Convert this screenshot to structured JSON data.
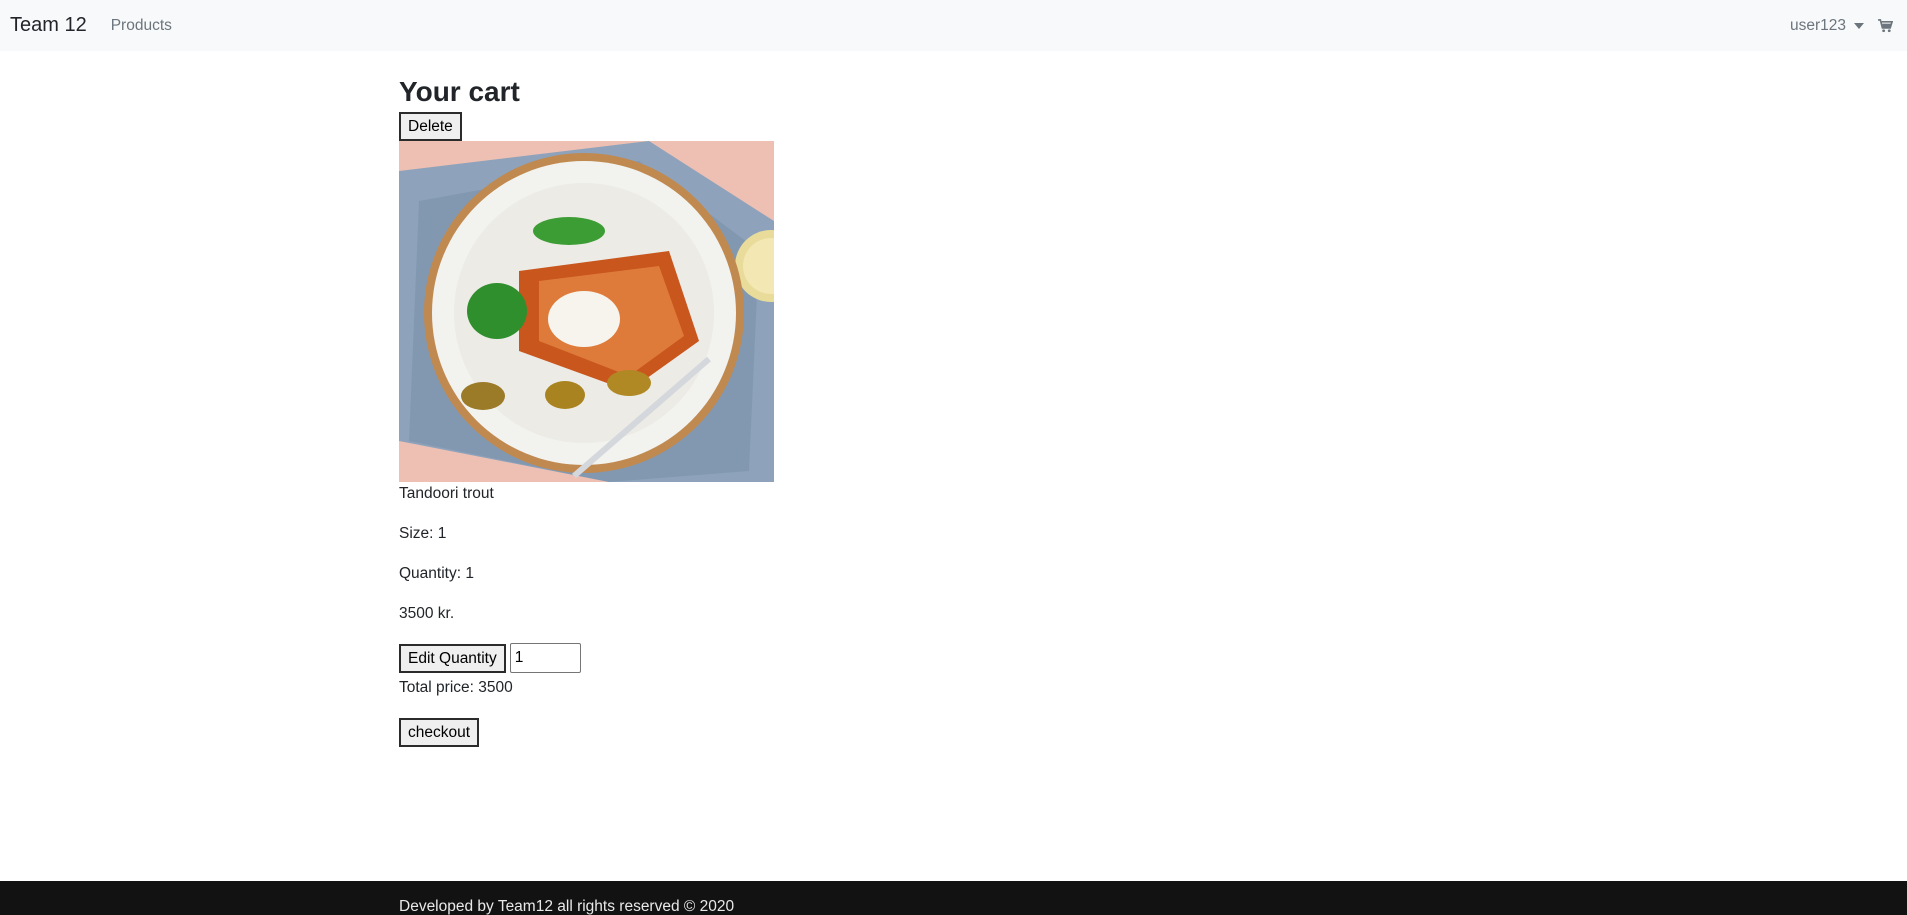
{
  "navbar": {
    "brand": "Team 12",
    "links": [
      {
        "label": "Products"
      }
    ],
    "user": "user123",
    "icons": {
      "cart": "shopping-cart-icon",
      "caret": "caret-down-icon"
    }
  },
  "cart": {
    "title": "Your cart",
    "delete_label": "Delete",
    "items": [
      {
        "name": "Tandoori trout",
        "size_text": "Size: 1",
        "quantity_text": "Quantity: 1",
        "price_text": "3500 kr.",
        "image": "tandoori-trout-plate-image"
      }
    ],
    "edit_quantity_label": "Edit Quantity",
    "quantity_value": "1",
    "total_text": "Total price: 3500",
    "checkout_label": "checkout"
  },
  "footer": {
    "text": "Developed by Team12 all rights reserved © 2020"
  },
  "colors": {
    "navbar_bg": "#f8f9fa",
    "footer_bg": "#121212",
    "text": "#212529",
    "muted": "#6c757d"
  }
}
